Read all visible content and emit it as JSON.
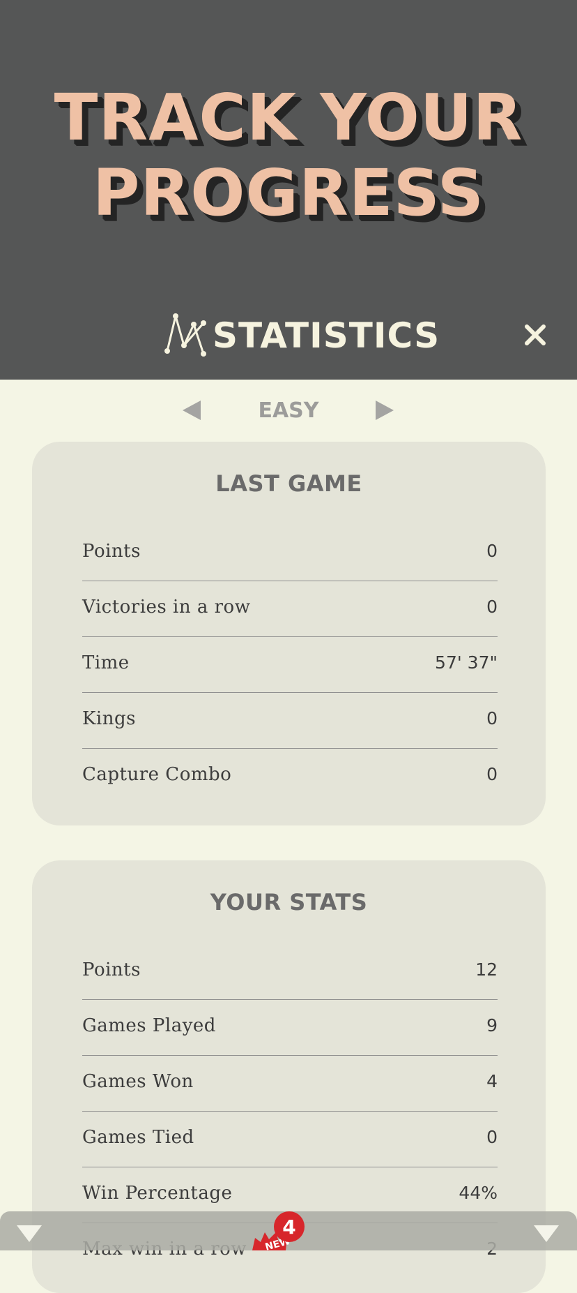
{
  "hero": {
    "title_line1": "TRACK YOUR",
    "title_line2": "PROGRESS"
  },
  "header": {
    "title": "STATISTICS",
    "icon": "stats-graph-icon",
    "close_icon": "close-icon"
  },
  "difficulty": {
    "label": "EASY",
    "prev_icon": "triangle-left-icon",
    "next_icon": "triangle-right-icon"
  },
  "last_game": {
    "title": "LAST GAME",
    "rows": [
      {
        "label": "Points",
        "value": "0"
      },
      {
        "label": "Victories in a row",
        "value": "0"
      },
      {
        "label": "Time",
        "value": "57' 37\""
      },
      {
        "label": "Kings",
        "value": "0"
      },
      {
        "label": "Capture Combo",
        "value": "0"
      }
    ]
  },
  "your_stats": {
    "title": "YOUR STATS",
    "rows": [
      {
        "label": "Points",
        "value": "12"
      },
      {
        "label": "Games Played",
        "value": "9"
      },
      {
        "label": "Games Won",
        "value": "4"
      },
      {
        "label": "Games Tied",
        "value": "0"
      },
      {
        "label": "Win Percentage",
        "value": "44%"
      },
      {
        "label": "Max win in a row",
        "value": "2"
      }
    ]
  },
  "bottom_bar": {
    "badge_count": "4",
    "badge_text": "NEW"
  },
  "colors": {
    "hero_bg": "#555656",
    "title_fill": "#efc1a5",
    "page_bg": "#f4f5e5",
    "card_bg": "#e4e4d8",
    "badge_red": "#d7262b"
  }
}
